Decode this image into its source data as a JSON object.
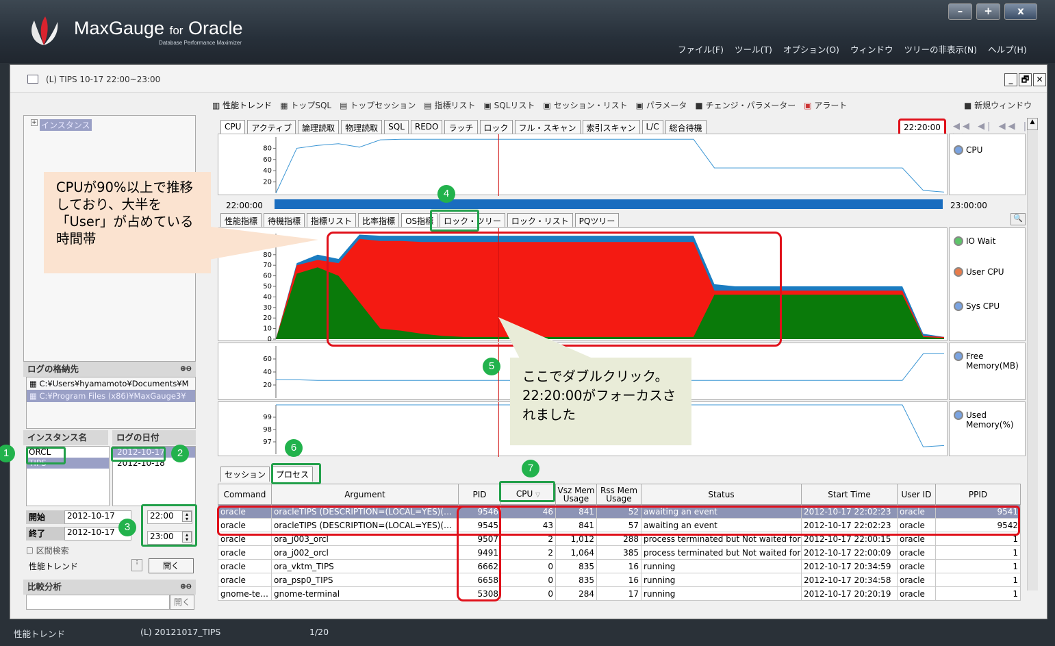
{
  "app": {
    "title": "MaxGauge",
    "title_for": "for",
    "title_db": "Oracle",
    "subtitle": "Database Performance Maximizer",
    "window_buttons": [
      "–",
      "+",
      "x"
    ],
    "menu": [
      "ファイル(F)",
      "ツール(T)",
      "オプション(O)",
      "ウィンドウ",
      "ツリーの非表示(N)",
      "ヘルプ(H)"
    ]
  },
  "inner_window": {
    "title": "(L) TIPS 10-17 22:00~23:00",
    "buttons": [
      "_",
      "🗗",
      "✕"
    ]
  },
  "left": {
    "tree_root": "インスタンス",
    "log_section": "ログの格納先",
    "log_paths": [
      "C:¥Users¥hyamamoto¥Documents¥M",
      "C:¥Program Files (x86)¥MaxGauge3¥"
    ],
    "instance_header": "インスタンス名",
    "date_header": "ログの日付",
    "instances": [
      "ORCL",
      "TIPS"
    ],
    "dates": [
      "2012-10-17",
      "2012-10-18"
    ],
    "start_label": "開始",
    "start_date": "2012-10-17",
    "start_time": "22:00",
    "end_label": "終了",
    "end_date": "2012-10-17",
    "end_time": "23:00",
    "range_search": "区間検索",
    "mode": "性能トレンド",
    "open_button": "開く",
    "compare_section": "比較分析",
    "compare_open": "開く"
  },
  "toolbar": {
    "items": [
      "性能トレンド",
      "トップSQL",
      "トップセッション",
      "指標リスト",
      "SQLリスト",
      "セッション・リスト",
      "パラメータ",
      "チェンジ・パラメーター",
      "アラート"
    ],
    "new_window": "新規ウィンドウ"
  },
  "tabs1": [
    "CPU",
    "アクティブ",
    "論理読取",
    "物理読取",
    "SQL",
    "REDO",
    "ラッチ",
    "ロック",
    "フル・スキャン",
    "索引スキャン",
    "L/C",
    "総合待機"
  ],
  "focus_time": "22:20:00",
  "range": {
    "start": "22:00:00",
    "end": "23:00:00"
  },
  "tabs2": [
    "性能指標",
    "待機指標",
    "指標リスト",
    "比率指標",
    "OS指標",
    "ロック・ツリー",
    "ロック・リスト",
    "PQツリー"
  ],
  "legends": {
    "cpu": "CPU",
    "os": [
      "IO Wait",
      "User CPU",
      "Sys CPU"
    ],
    "free": [
      "Free",
      "Memory(MB)"
    ],
    "used": [
      "Used",
      "Memory(%)"
    ]
  },
  "colors": {
    "io_wait": "#1a7cc1",
    "user_cpu": "#f41a12",
    "sys_cpu": "#0a7a0a",
    "line": "#3a95d4",
    "accent_red": "#e0101a",
    "accent_green": "#22a04a"
  },
  "chart_data": [
    {
      "type": "line",
      "series": [
        {
          "name": "CPU",
          "values": [
            0,
            80,
            85,
            88,
            82,
            95,
            96,
            96,
            96,
            96,
            96,
            96,
            96,
            96,
            96,
            96,
            96,
            96,
            96,
            96,
            96,
            45,
            45,
            45,
            45,
            45,
            45,
            45,
            45,
            45,
            45,
            5,
            2
          ]
        }
      ],
      "yticks": [
        20,
        40,
        60,
        80
      ]
    },
    {
      "type": "area",
      "series": [
        {
          "name": "Sys CPU",
          "values": [
            0,
            62,
            68,
            60,
            35,
            10,
            8,
            5,
            3,
            2,
            2,
            2,
            2,
            2,
            2,
            2,
            2,
            2,
            2,
            2,
            2,
            42,
            42,
            42,
            42,
            42,
            42,
            42,
            42,
            42,
            42,
            2,
            1
          ]
        },
        {
          "name": "User CPU",
          "values": [
            0,
            70,
            75,
            72,
            95,
            93,
            93,
            92,
            92,
            92,
            92,
            92,
            92,
            92,
            92,
            92,
            92,
            92,
            92,
            92,
            92,
            46,
            46,
            46,
            46,
            46,
            46,
            46,
            46,
            46,
            46,
            3,
            2
          ]
        },
        {
          "name": "IO Wait",
          "values": [
            0,
            72,
            80,
            76,
            99,
            98,
            98,
            98,
            98,
            98,
            98,
            98,
            98,
            98,
            98,
            98,
            98,
            98,
            98,
            98,
            98,
            52,
            50,
            50,
            50,
            50,
            50,
            50,
            50,
            50,
            50,
            5,
            2
          ]
        }
      ],
      "yticks": [
        0,
        10,
        20,
        30,
        40,
        50,
        60,
        70,
        80
      ]
    },
    {
      "type": "line",
      "series": [
        {
          "name": "Free Memory(MB)",
          "values": [
            28,
            28,
            27,
            27,
            27,
            27,
            27,
            27,
            27,
            27,
            27,
            27,
            27,
            27,
            27,
            27,
            27,
            27,
            27,
            27,
            27,
            27,
            27,
            27,
            27,
            27,
            27,
            27,
            27,
            27,
            27,
            68,
            68
          ]
        }
      ],
      "yticks": [
        20,
        40,
        60
      ]
    },
    {
      "type": "line",
      "series": [
        {
          "name": "Used Memory(%)",
          "values": [
            100,
            100,
            100,
            100,
            100,
            100,
            100,
            100,
            100,
            100,
            100,
            100,
            100,
            100,
            100,
            100,
            100,
            100,
            100,
            100,
            100,
            100,
            100,
            100,
            100,
            100,
            100,
            100,
            100,
            100,
            100,
            96.6,
            96.7
          ]
        }
      ],
      "yticks": [
        97,
        98,
        99
      ]
    }
  ],
  "bottom_tabs": [
    "セッション",
    "プロセス"
  ],
  "table": {
    "headers": [
      "Command",
      "Argument",
      "PID",
      "CPU",
      "Vsz Mem Usage",
      "Rss Mem Usage",
      "Status",
      "Start Time",
      "User ID",
      "PPID"
    ],
    "rows": [
      [
        "oracle",
        "oracleTIPS (DESCRIPTION=(LOCAL=YES)(…",
        "9546",
        "46",
        "841",
        "52",
        "awaiting an event",
        "2012-10-17 22:02:23",
        "oracle",
        "9541"
      ],
      [
        "oracle",
        "oracleTIPS (DESCRIPTION=(LOCAL=YES)(…",
        "9545",
        "43",
        "841",
        "57",
        "awaiting an event",
        "2012-10-17 22:02:23",
        "oracle",
        "9542"
      ],
      [
        "oracle",
        "ora_j003_orcl",
        "9507",
        "2",
        "1,012",
        "288",
        "process terminated but Not waited for",
        "2012-10-17 22:00:15",
        "oracle",
        "1"
      ],
      [
        "oracle",
        "ora_j002_orcl",
        "9491",
        "2",
        "1,064",
        "385",
        "process terminated but Not waited for",
        "2012-10-17 22:00:09",
        "oracle",
        "1"
      ],
      [
        "oracle",
        "ora_vktm_TIPS",
        "6662",
        "0",
        "835",
        "16",
        "running",
        "2012-10-17 20:34:59",
        "oracle",
        "1"
      ],
      [
        "oracle",
        "ora_psp0_TIPS",
        "6658",
        "0",
        "835",
        "16",
        "running",
        "2012-10-17 20:34:58",
        "oracle",
        "1"
      ],
      [
        "gnome-te…",
        "gnome-terminal",
        "5308",
        "0",
        "284",
        "17",
        "running",
        "2012-10-17 20:20:19",
        "oracle",
        "1"
      ]
    ]
  },
  "annotations": {
    "callout1": "CPUが90%以上で推移しており、大半を「User」が占めている時間帯",
    "callout2": "ここでダブルクリック。22:20:00がフォーカスされました",
    "badges": [
      "1",
      "2",
      "3",
      "4",
      "5",
      "6",
      "7"
    ]
  },
  "status": {
    "mode": "性能トレンド",
    "file": "(L) 20121017_TIPS",
    "page": "1/20"
  }
}
